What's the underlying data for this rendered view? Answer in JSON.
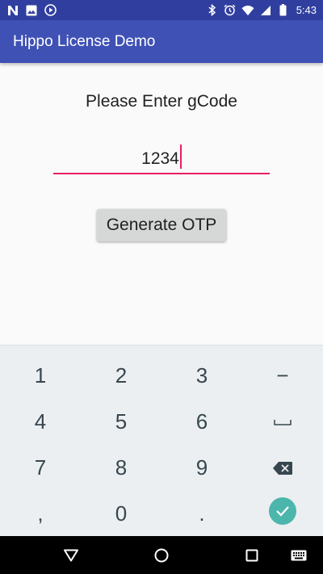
{
  "status_bar": {
    "time": "5:43",
    "left_icons": [
      "n-notification-icon",
      "image-notification-icon",
      "play-notification-icon"
    ],
    "right_icons": [
      "bluetooth-icon",
      "alarm-icon",
      "wifi-icon",
      "signal-icon",
      "battery-icon"
    ],
    "color": "#303f9f"
  },
  "app_bar": {
    "title": "Hippo License Demo",
    "color": "#3f51b5"
  },
  "main": {
    "prompt": "Please Enter gCode",
    "code_input": {
      "value": "1234",
      "accent_color": "#e91e63"
    },
    "generate_button": {
      "label": "Generate OTP"
    }
  },
  "keyboard": {
    "rows": [
      [
        "1",
        "2",
        "3",
        "−"
      ],
      [
        "4",
        "5",
        "6",
        "space-key-icon"
      ],
      [
        "7",
        "8",
        "9",
        "backspace-key-icon"
      ],
      [
        ",",
        "0",
        ".",
        "done-key-icon"
      ]
    ],
    "enter_color": "#4db6ac"
  },
  "nav_bar": {
    "buttons": [
      "back-icon",
      "home-icon",
      "recents-icon",
      "keyboard-switch-icon"
    ]
  }
}
